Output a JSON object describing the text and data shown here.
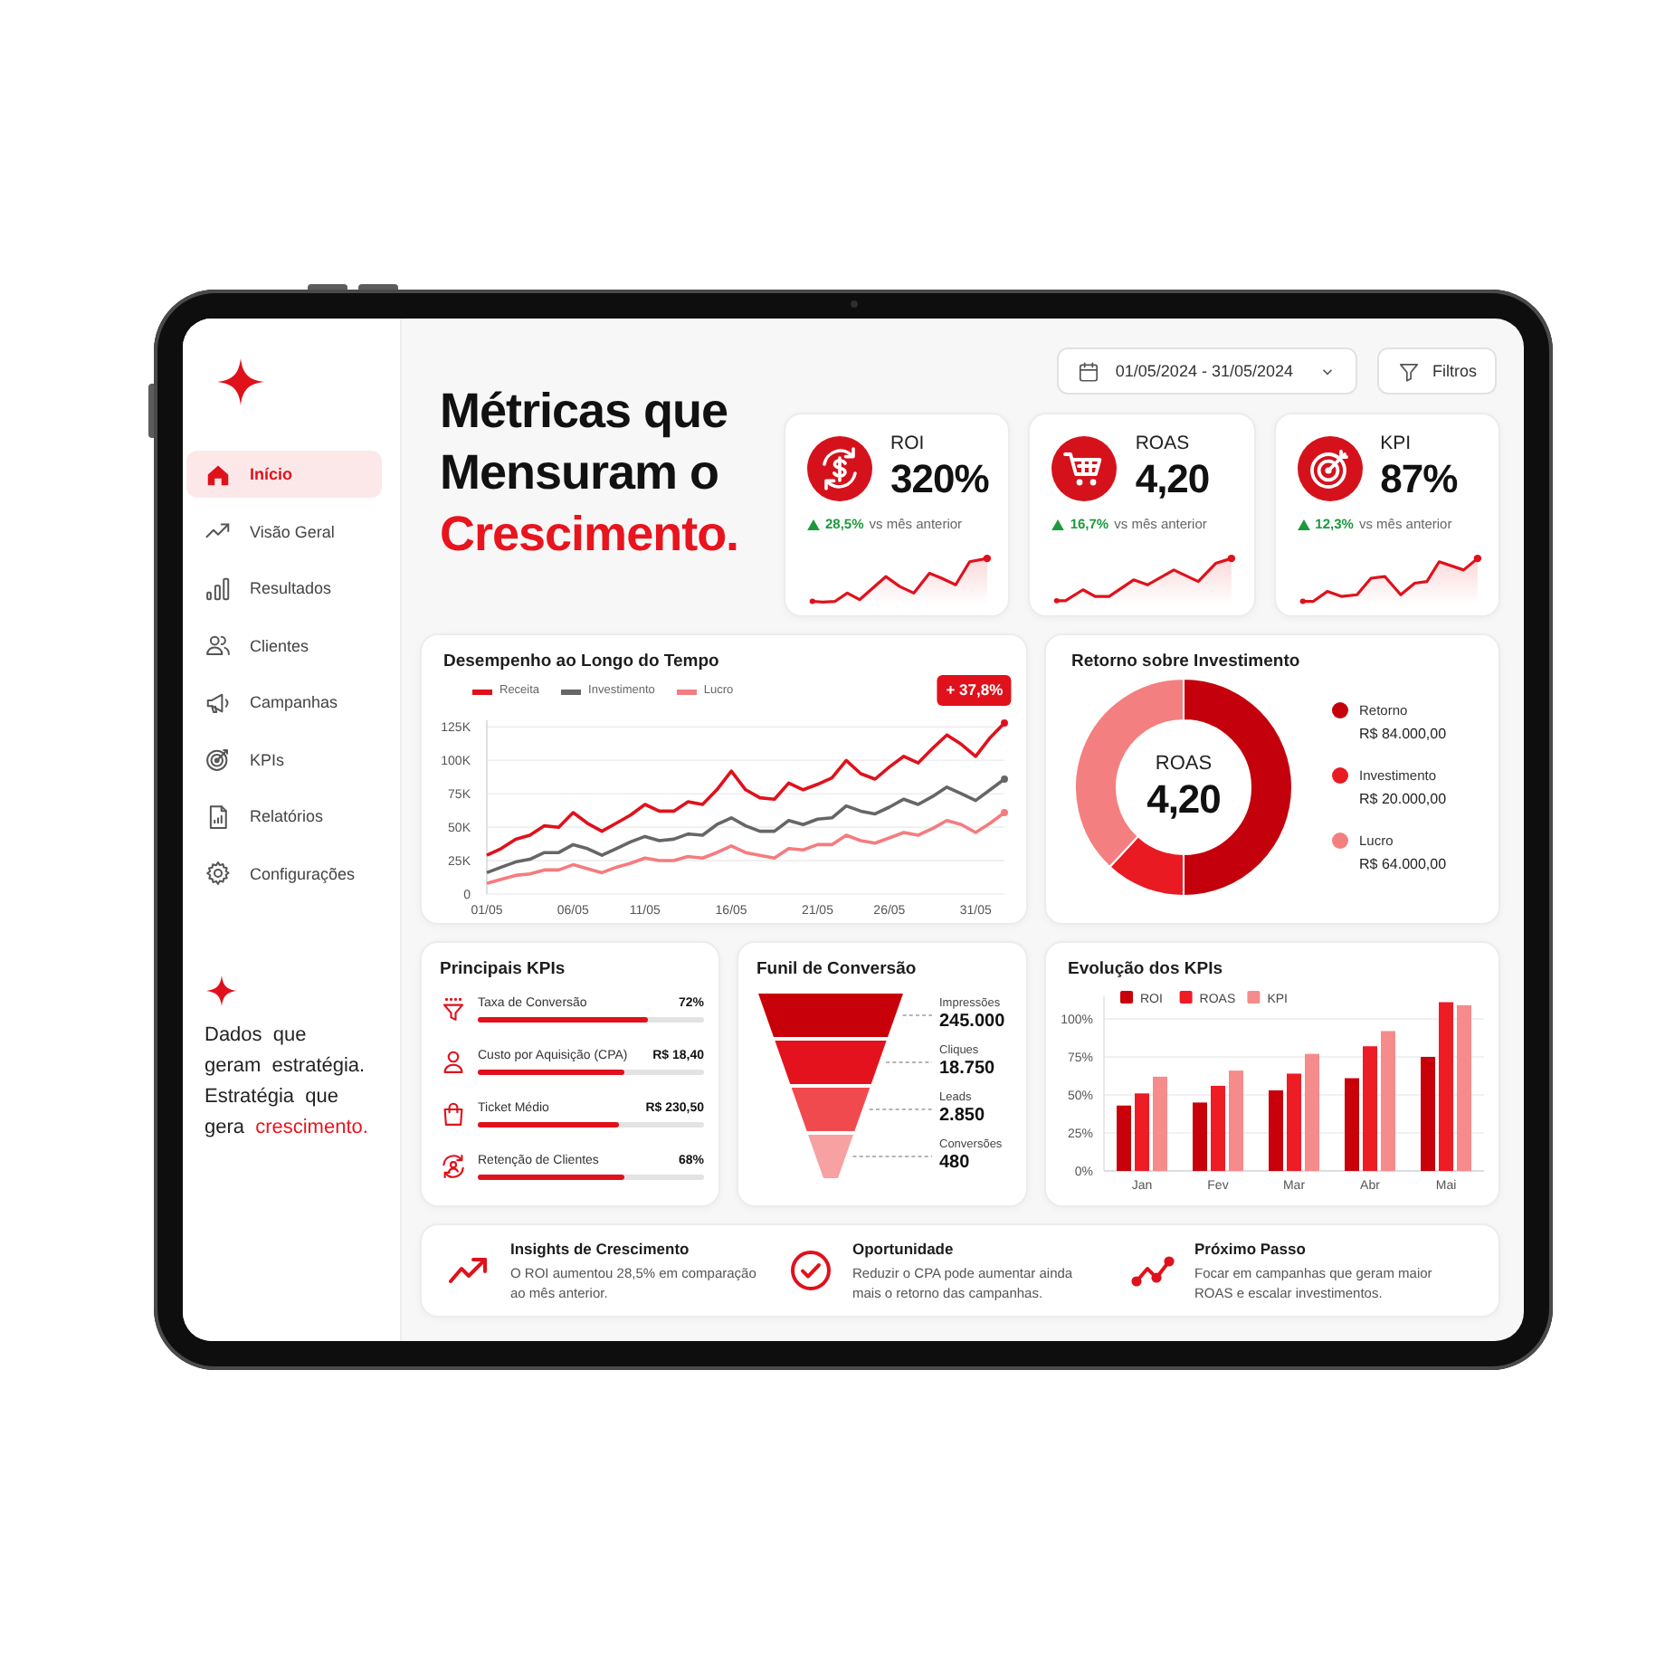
{
  "sidebar": {
    "items": [
      {
        "label": "Início",
        "selected": true
      },
      {
        "label": "Visão Geral",
        "selected": false
      },
      {
        "label": "Resultados",
        "selected": false
      },
      {
        "label": "Clientes",
        "selected": false
      },
      {
        "label": "Campanhas",
        "selected": false
      },
      {
        "label": "KPIs",
        "selected": false
      },
      {
        "label": "Relatórios",
        "selected": false
      },
      {
        "label": "Configurações",
        "selected": false
      }
    ],
    "tagline": "Dados que geram estratégia. Estratégia que gera **crescimento.**"
  },
  "header": {
    "title": "Métricas que Mensuram o **Crescimento.**",
    "date_range": "01/05/2024 - 31/05/2024",
    "filter_button": "Filtros"
  },
  "kpi_cards": [
    {
      "label": "ROI",
      "value": "320%",
      "rising": true,
      "change": "28,5%",
      "change_note": "vs mês anterior"
    },
    {
      "label": "ROAS",
      "value": "4,20",
      "rising": true,
      "change": "16,7%",
      "change_note": "vs mês anterior"
    },
    {
      "label": "KPI",
      "value": "87%",
      "rising": true,
      "change": "12,3%",
      "change_note": "vs mês anterior"
    }
  ],
  "performance_chart": {
    "chart_data": {
      "type": "line",
      "title": "Desempenho ao Longo do Tempo",
      "categories": [
        "01/05",
        null,
        null,
        null,
        null,
        null,
        "06/05",
        null,
        null,
        null,
        null,
        "11/05",
        null,
        null,
        null,
        null,
        null,
        "16/05",
        null,
        null,
        null,
        null,
        null,
        "21/05",
        null,
        null,
        null,
        null,
        "26/05",
        null,
        null,
        null,
        null,
        null,
        "31/05",
        null,
        null
      ],
      "series": [
        {
          "name": "Receita",
          "color": "#e0111b",
          "values": [
            29,
            34,
            41,
            44,
            51,
            50,
            61,
            53,
            47,
            53,
            59,
            67,
            62,
            62,
            69,
            67,
            78,
            92,
            78,
            72,
            71,
            83,
            78,
            82,
            87,
            100,
            90,
            86,
            95,
            103,
            98,
            109,
            119,
            112,
            103,
            117,
            128
          ]
        },
        {
          "name": "Investimento",
          "color": "#666666",
          "values": [
            16,
            20,
            24,
            26,
            31,
            31,
            37,
            34,
            29,
            34,
            39,
            43,
            40,
            41,
            45,
            44,
            52,
            57,
            51,
            47,
            47,
            55,
            52,
            56,
            57,
            66,
            62,
            60,
            65,
            71,
            67,
            73,
            80,
            75,
            70,
            78,
            86
          ]
        },
        {
          "name": "Lucro",
          "color": "#f47c7f",
          "values": [
            8,
            11,
            14,
            15,
            18,
            18,
            22,
            19,
            16,
            20,
            23,
            27,
            25,
            25,
            28,
            27,
            31,
            36,
            31,
            29,
            27,
            34,
            33,
            37,
            37,
            44,
            40,
            38,
            42,
            46,
            44,
            49,
            55,
            52,
            46,
            53,
            61
          ]
        }
      ],
      "ylim": [
        0,
        130
      ],
      "yticks": [
        {
          "value": 0,
          "label": "0"
        },
        {
          "value": 25,
          "label": "25K"
        },
        {
          "value": 50,
          "label": "50K"
        },
        {
          "value": 75,
          "label": "75K"
        },
        {
          "value": 100,
          "label": "100K"
        },
        {
          "value": 125,
          "label": "125K"
        }
      ],
      "grid": true,
      "legend": "top",
      "annotations": [
        "+ 37,8%"
      ]
    }
  },
  "roi_breakdown": {
    "center_label": "ROAS",
    "center_value": "4,20",
    "legend": [
      {
        "amount": "R$ 84.000,00",
        "color": "#c4000c"
      },
      {
        "amount": "R$ 20.000,00",
        "color": "#ea1a22"
      },
      {
        "amount": "R$ 64.000,00",
        "color": "#f47f80"
      }
    ],
    "chart_data": {
      "type": "donut",
      "title": "Retorno sobre Investimento",
      "categories": [
        "Retorno",
        "Investimento",
        "Lucro"
      ],
      "values": [
        50,
        11.9,
        38.1
      ],
      "legend": "right"
    }
  },
  "top_kpis": {
    "title": "Principais KPIs",
    "items": [
      {
        "label": "Taxa de Conversão",
        "value": "72%",
        "level": 0.75
      },
      {
        "label": "Custo por Aquisição (CPA)",
        "value": "R$ 18,40",
        "level": 0.65
      },
      {
        "label": "Ticket Médio",
        "value": "R$ 230,50",
        "level": 0.62
      },
      {
        "label": "Retenção de Clientes",
        "value": "68%",
        "level": 0.65
      }
    ]
  },
  "funnel": {
    "title": "Funil de Conversão",
    "stages": [
      {
        "label": "Impressões",
        "value": "245.000",
        "color": "#c8000a"
      },
      {
        "label": "Cliques",
        "value": "18.750",
        "color": "#e3121c"
      },
      {
        "label": "Leads",
        "value": "2.850",
        "color": "#f04a4f"
      },
      {
        "label": "Conversões",
        "value": "480",
        "color": "#f7a1a3"
      }
    ]
  },
  "kpi_evolution": {
    "chart_data": {
      "type": "bar",
      "title": "Evolução dos KPIs",
      "categories": [
        "Jan",
        "Fev",
        "Mar",
        "Abr",
        "Mai"
      ],
      "series": [
        {
          "name": "ROI",
          "color": "#c8000a",
          "values": [
            43,
            45,
            53,
            61,
            75
          ]
        },
        {
          "name": "ROAS",
          "color": "#ee1c25",
          "values": [
            51,
            56,
            64,
            82,
            111
          ]
        },
        {
          "name": "KPI",
          "color": "#f68b8b",
          "values": [
            62,
            66,
            77,
            92,
            109
          ]
        }
      ],
      "ylim": [
        0,
        115
      ],
      "yticks": [
        {
          "value": 0,
          "label": "0%"
        },
        {
          "value": 25,
          "label": "25%"
        },
        {
          "value": 50,
          "label": "50%"
        },
        {
          "value": 75,
          "label": "75%"
        },
        {
          "value": 100,
          "label": "100%"
        }
      ],
      "grid": true,
      "legend": "top"
    }
  },
  "insights": [
    {
      "title": "Insights de Crescimento",
      "text": "O ROI aumentou 28,5% em comparação ao mês anterior."
    },
    {
      "title": "Oportunidade",
      "text": "Reduzir o CPA pode aumentar ainda mais o retorno das campanhas."
    },
    {
      "title": "Próximo Passo",
      "text": "Focar em campanhas que geram maior ROAS e escalar investimentos."
    }
  ]
}
